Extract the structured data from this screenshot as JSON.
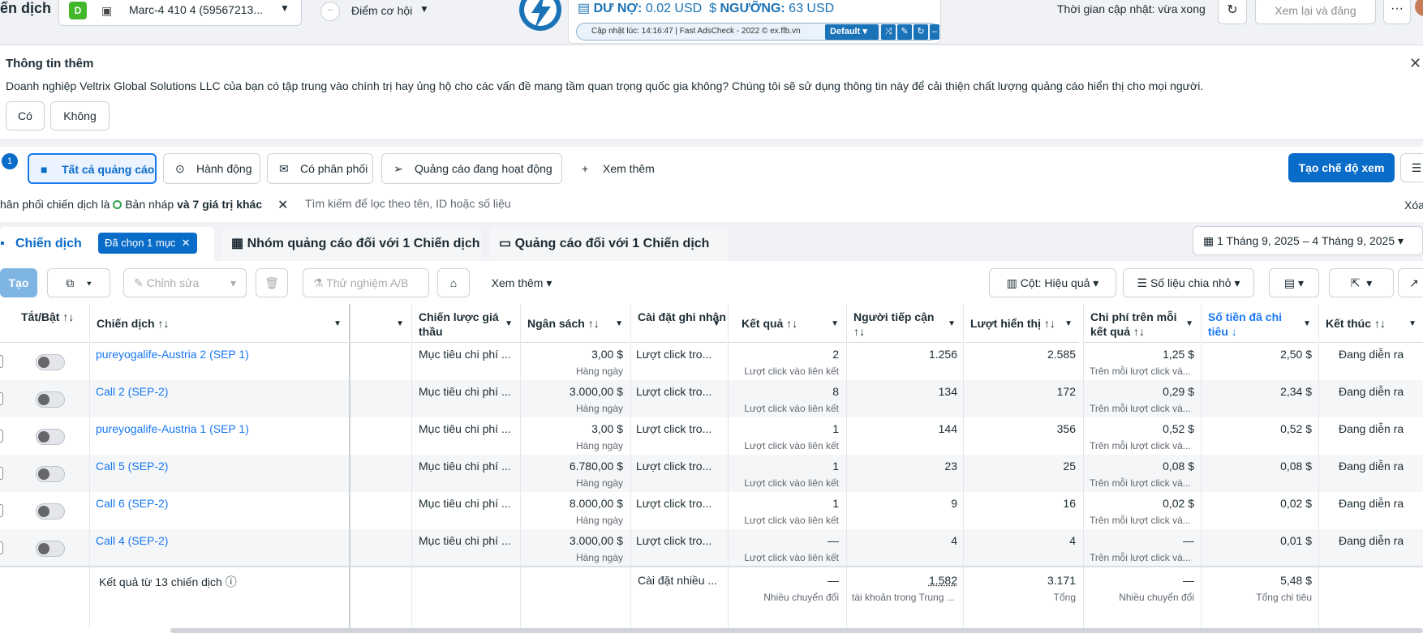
{
  "header": {
    "title_fragment": "ến dịch",
    "account": {
      "badge": "D",
      "name": "Marc-4 410 4 (59567213..."
    },
    "opportunity_label": "Điểm cơ hội",
    "fac": {
      "debt_label": "DƯ NỢ:",
      "debt_value": "0.02 USD",
      "threshold_label": "NGƯỠNG:",
      "threshold_value": "63 USD",
      "updated_text": "Cập nhật lúc: 14:16:47 | Fast AdsCheck - 2022 © ex.ffb.vn",
      "mode": "Default"
    },
    "update_time": "Thời gian cập nhật: vừa xong",
    "review_button": "Xem lại và đăng",
    "more_button": "···"
  },
  "info_banner": {
    "title": "Thông tin thêm",
    "text": "Doanh nghiệp Veltrix Global Solutions LLC của bạn có tập trung vào chính trị hay ủng hộ cho các vấn đề mang tầm quan trọng quốc gia không? Chúng tôi sẽ sử dụng thông tin này để cải thiện chất lượng quảng cáo hiển thị cho mọi người.",
    "yes": "Có",
    "no": "Không"
  },
  "filters": {
    "search_badge": "1",
    "chips": [
      "Tất cả quảng cáo",
      "Hành động",
      "Có phân phối",
      "Quảng cáo đang hoạt động",
      "Xem thêm"
    ],
    "create_view": "Tạo chế độ xem",
    "active_filter_prefix": "hân phối chiến dịch là",
    "active_filter_value": "Bản nháp",
    "active_filter_suffix": "và 7 giá trị khác",
    "search_placeholder": "Tìm kiếm để lọc theo tên, ID hoặc số liệu",
    "clear": "Xóa"
  },
  "tabs": {
    "campaigns": "Chiến dịch",
    "selected": "Đã chọn 1 mục",
    "adsets": "Nhóm quảng cáo đối với 1 Chiến dịch",
    "ads": "Quảng cáo đối với 1 Chiến dịch",
    "date_range": "1 Tháng 9, 2025 – 4 Tháng 9, 2025"
  },
  "toolbar": {
    "create": "Tạo",
    "edit": "Chỉnh sửa",
    "ab_test": "Thử nghiệm A/B",
    "more": "Xem thêm",
    "columns": "Cột: Hiệu quả",
    "breakdown": "Số liệu chia nhỏ"
  },
  "table": {
    "headers": {
      "toggle": "Tắt/Bật ↑↓",
      "campaign": "Chiến dịch ↑↓",
      "bid": "Chiến lược giá thầu",
      "budget": "Ngân sách ↑↓",
      "attribution": "Cài đặt ghi nhận",
      "results": "Kết quả ↑↓",
      "reach": "Người tiếp cận ↑↓",
      "impressions": "Lượt hiển thị ↑↓",
      "cpr": "Chi phí trên mỗi kết quả ↑↓",
      "spent": "Số tiền đã chi tiêu ↓",
      "ends": "Kết thúc ↑↓"
    },
    "rows": [
      {
        "name": "pureyogalife-Austria 2 (SEP 1)",
        "bid": "Mục tiêu chi phí ...",
        "budget": "3,00 $",
        "budget_sub": "Hàng ngày",
        "attribution": "Lượt click tro...",
        "results": "2",
        "results_sub": "Lượt click vào liên kết",
        "reach": "1.256",
        "impressions": "2.585",
        "cpr": "1,25 $",
        "cpr_sub": "Trên mỗi lượt click và...",
        "spent": "2,50 $",
        "ends": "Đang diễn ra"
      },
      {
        "name": "Call 2 (SEP-2)",
        "bid": "Mục tiêu chi phí ...",
        "budget": "3.000,00 $",
        "budget_sub": "Hàng ngày",
        "attribution": "Lượt click tro...",
        "results": "8",
        "results_sub": "Lượt click vào liên kết",
        "reach": "134",
        "impressions": "172",
        "cpr": "0,29 $",
        "cpr_sub": "Trên mỗi lượt click và...",
        "spent": "2,34 $",
        "ends": "Đang diễn ra"
      },
      {
        "name": "pureyogalife-Austria 1 (SEP 1)",
        "bid": "Mục tiêu chi phí ...",
        "budget": "3,00 $",
        "budget_sub": "Hàng ngày",
        "attribution": "Lượt click tro...",
        "results": "1",
        "results_sub": "Lượt click vào liên kết",
        "reach": "144",
        "impressions": "356",
        "cpr": "0,52 $",
        "cpr_sub": "Trên mỗi lượt click và...",
        "spent": "0,52 $",
        "ends": "Đang diễn ra"
      },
      {
        "name": "Call 5 (SEP-2)",
        "bid": "Mục tiêu chi phí ...",
        "budget": "6.780,00 $",
        "budget_sub": "Hàng ngày",
        "attribution": "Lượt click tro...",
        "results": "1",
        "results_sub": "Lượt click vào liên kết",
        "reach": "23",
        "impressions": "25",
        "cpr": "0,08 $",
        "cpr_sub": "Trên mỗi lượt click và...",
        "spent": "0,08 $",
        "ends": "Đang diễn ra"
      },
      {
        "name": "Call 6 (SEP-2)",
        "bid": "Mục tiêu chi phí ...",
        "budget": "8.000,00 $",
        "budget_sub": "Hàng ngày",
        "attribution": "Lượt click tro...",
        "results": "1",
        "results_sub": "Lượt click vào liên kết",
        "reach": "9",
        "impressions": "16",
        "cpr": "0,02 $",
        "cpr_sub": "Trên mỗi lượt click và...",
        "spent": "0,02 $",
        "ends": "Đang diễn ra"
      },
      {
        "name": "Call 4 (SEP-2)",
        "bid": "Mục tiêu chi phí ...",
        "budget": "3.000,00 $",
        "budget_sub": "Hàng ngày",
        "attribution": "Lượt click tro...",
        "results": "—",
        "results_sub": "Lượt click vào liên kết",
        "reach": "4",
        "impressions": "4",
        "cpr": "—",
        "cpr_sub": "Trên mỗi lượt click và...",
        "spent": "0,01 $",
        "ends": "Đang diễn ra"
      }
    ],
    "totals": {
      "label": "Kết quả từ 13 chiến dịch",
      "attribution": "Cài đặt nhiều ...",
      "results": "—",
      "results_sub": "Nhiều chuyển đổi",
      "reach": "1.582",
      "reach_sub": "tài khoản trong Trung ...",
      "impressions": "3.171",
      "impressions_sub": "Tổng",
      "cpr": "—",
      "cpr_sub": "Nhiều chuyển đổi",
      "spent": "5,48 $",
      "spent_sub": "Tổng chi tiêu"
    }
  },
  "colors": {
    "accent": "#0a6cc9",
    "link": "#1877f2",
    "fac_blue": "#1a73b7",
    "active_green": "#31a24c"
  }
}
